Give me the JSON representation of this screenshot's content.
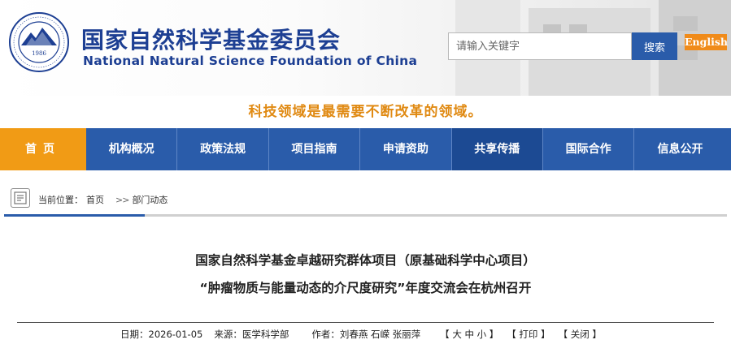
{
  "header": {
    "title_cn": "国家自然科学基金委员会",
    "title_en": "National Natural Science Foundation of China",
    "logo_year": "1986",
    "search_placeholder": "请输入关键字",
    "search_button": "搜索",
    "english_button": "English"
  },
  "slogan": "科技领域是最需要不断改革的领域。",
  "nav": {
    "items": [
      {
        "label": "首页"
      },
      {
        "label": "机构概况"
      },
      {
        "label": "政策法规"
      },
      {
        "label": "项目指南"
      },
      {
        "label": "申请资助"
      },
      {
        "label": "共享传播"
      },
      {
        "label": "国际合作"
      },
      {
        "label": "信息公开"
      }
    ],
    "active_index": 5
  },
  "breadcrumb": {
    "prefix": "当前位置：",
    "home": "首页",
    "separator": ">>",
    "current": "部门动态"
  },
  "article": {
    "title_line1": "国家自然科学基金卓越研究群体项目（原基础科学中心项目）",
    "title_line2": "“肿瘤物质与能量动态的介尺度研究”年度交流会在杭州召开",
    "date_label": "日期：",
    "date": "2026-01-05",
    "source_label": "来源：",
    "source": "医学科学部",
    "author_label": "作者：",
    "authors": "刘春燕 石嵘 张丽萍",
    "font_size_open": "【",
    "font_large": "大",
    "font_medium": "中",
    "font_small": "小",
    "font_size_close": "】",
    "print": "【 打印 】",
    "close": "【 关闭 】"
  },
  "colors": {
    "primary_blue": "#2a5caa",
    "home_orange": "#f19b15",
    "slogan_orange": "#e08a13",
    "english_orange": "#f08b1a",
    "title_blue": "#1d3f93"
  }
}
